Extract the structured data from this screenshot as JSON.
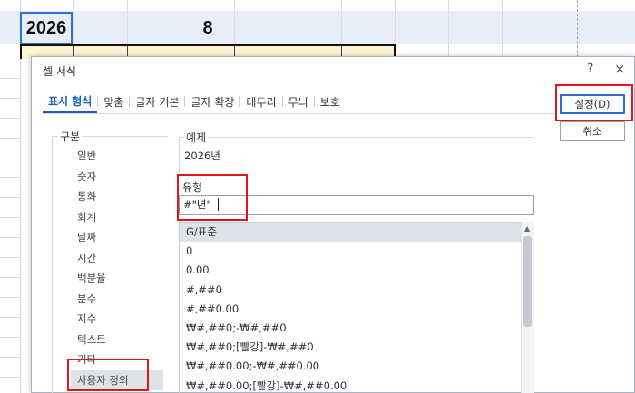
{
  "sheet": {
    "cell_year": "2026",
    "cell_month": "8"
  },
  "dialog": {
    "title": "셀 서식",
    "help": "?",
    "close": "×",
    "tabs": [
      {
        "label": "표시 형식",
        "active": true
      },
      {
        "label": "맞춤"
      },
      {
        "label": "글자 기본"
      },
      {
        "label": "글자 확장"
      },
      {
        "label": "테두리"
      },
      {
        "label": "무늬"
      },
      {
        "label": "보호"
      }
    ],
    "category": {
      "legend": "구분",
      "items": [
        "일반",
        "숫자",
        "통화",
        "회계",
        "날짜",
        "시간",
        "백분율",
        "분수",
        "지수",
        "텍스트",
        "기타",
        "사용자 정의"
      ],
      "selected": "사용자 정의"
    },
    "example": {
      "legend": "예제",
      "value": "2026년"
    },
    "type": {
      "label": "유형",
      "value": "#\"년\""
    },
    "formats": [
      "G/표준",
      "0",
      "0.00",
      "#,##0",
      "#,##0.00",
      "₩#,##0;-₩#,##0",
      "₩#,##0;[빨강]-₩#,##0",
      "₩#,##0.00;-₩#,##0.00",
      "₩#,##0.00;[빨강]-₩#,##0.00"
    ],
    "buttons": {
      "ok": "설정(D)",
      "cancel": "취소"
    }
  },
  "colors": {
    "accent": "#1d5fbf",
    "highlight": "#e0161c"
  }
}
